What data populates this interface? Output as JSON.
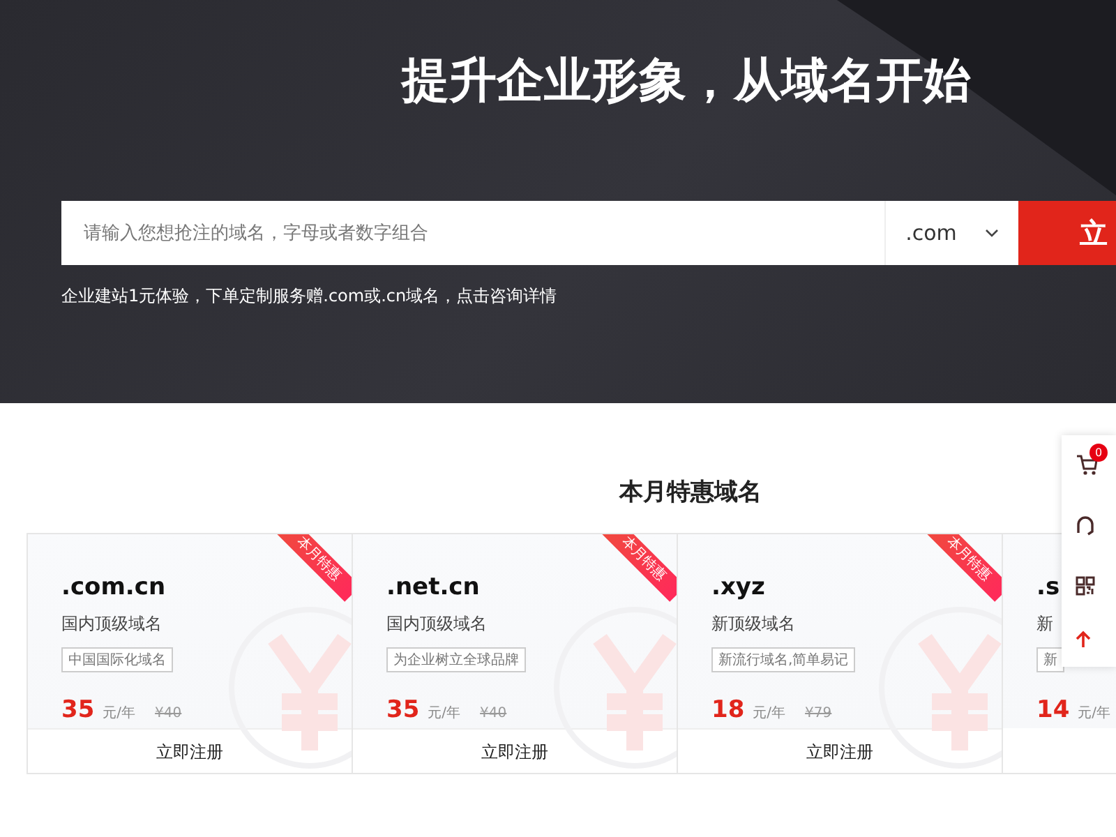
{
  "banner": {
    "title": "提升企业形象，从域名开始",
    "search": {
      "placeholder": "请输入您想抢注的域名，字母或者数字组合",
      "suffix": ".com",
      "button": "立"
    },
    "note": "企业建站1元体验，下单定制服务赠.com或.cn域名，点击咨询详情"
  },
  "section": {
    "title": "本月特惠域名",
    "cards": [
      {
        "name": ".com.cn",
        "subtitle": "国内顶级域名",
        "tag": "中国国际化域名",
        "price": "35",
        "unit": "元/年",
        "old_price": "¥40",
        "ribbon": "本月特惠",
        "button": "立即注册"
      },
      {
        "name": ".net.cn",
        "subtitle": "国内顶级域名",
        "tag": "为企业树立全球品牌",
        "price": "35",
        "unit": "元/年",
        "old_price": "¥40",
        "ribbon": "本月特惠",
        "button": "立即注册"
      },
      {
        "name": ".xyz",
        "subtitle": "新顶级域名",
        "tag": "新流行域名,简单易记",
        "price": "18",
        "unit": "元/年",
        "old_price": "¥79",
        "ribbon": "本月特惠",
        "button": "立即注册"
      },
      {
        "name": ".s",
        "subtitle": "新",
        "tag": "新",
        "price": "14",
        "unit": "元/年"
      }
    ]
  },
  "sidebar": {
    "cart_count": "0"
  }
}
